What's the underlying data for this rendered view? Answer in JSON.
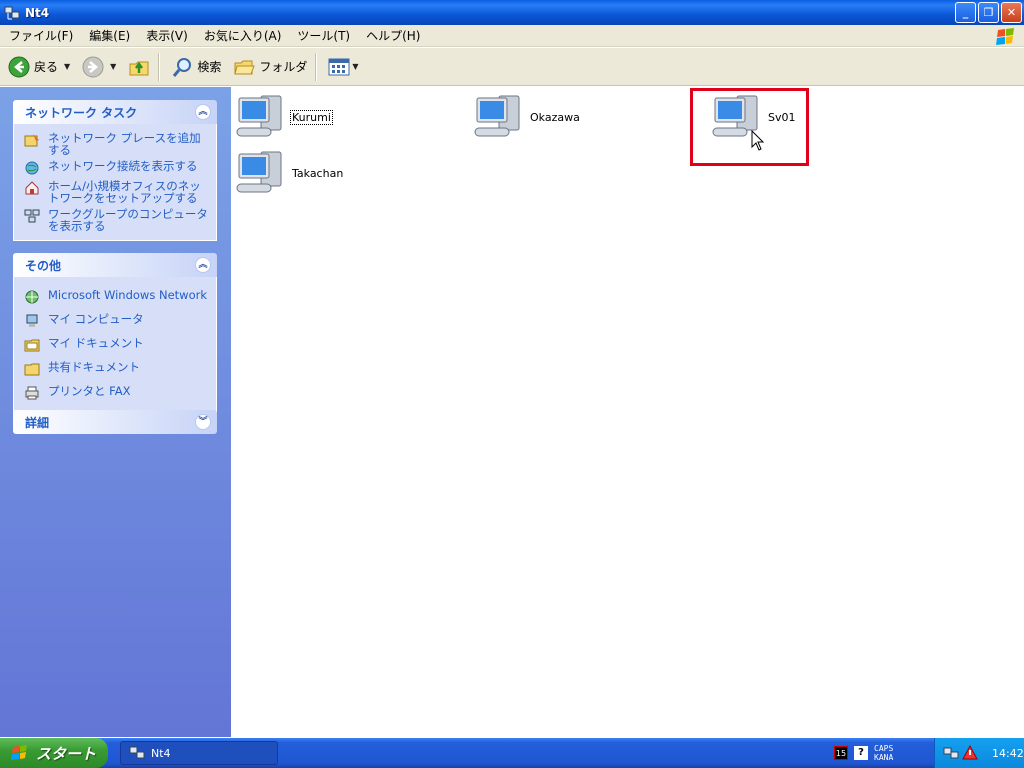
{
  "window": {
    "title": "Nt4"
  },
  "menu": [
    "ファイル(F)",
    "編集(E)",
    "表示(V)",
    "お気に入り(A)",
    "ツール(T)",
    "ヘルプ(H)"
  ],
  "toolbar": {
    "back": "戻る",
    "search": "検索",
    "folders": "フォルダ"
  },
  "network_tasks": {
    "title": "ネットワーク タスク",
    "items": [
      "ネットワーク プレースを追加する",
      "ネットワーク接続を表示する",
      "ホーム/小規模オフィスのネットワークをセットアップする",
      "ワークグループのコンピュータを表示する"
    ]
  },
  "other_places": {
    "title": "その他",
    "items": [
      "Microsoft Windows Network",
      "マイ コンピュータ",
      "マイ ドキュメント",
      "共有ドキュメント",
      "プリンタと FAX"
    ]
  },
  "details": {
    "title": "詳細"
  },
  "computers": [
    "Kurumi",
    "Okazawa",
    "Sv01",
    "Takachan"
  ],
  "taskbar": {
    "start": "スタート",
    "task": "Nt4",
    "lang_badge": "15",
    "caps": "CAPS",
    "kana": "KANA",
    "clock": "14:42"
  }
}
